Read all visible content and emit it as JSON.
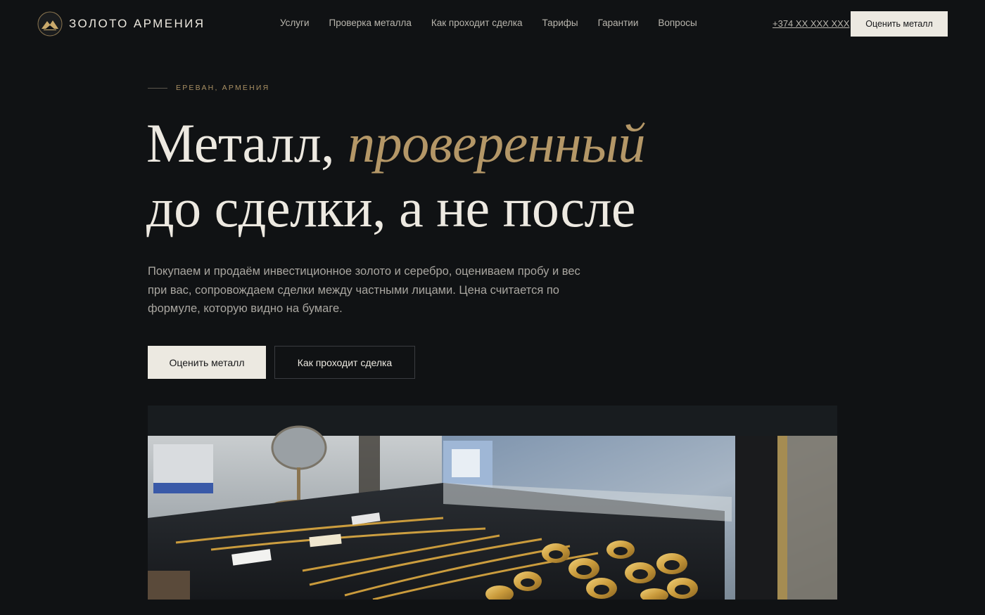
{
  "brand": {
    "name": "ЗОЛОТО АРМЕНИЯ",
    "logo_icon": "mountain-logo-icon"
  },
  "nav": {
    "items": [
      {
        "label": "Услуги"
      },
      {
        "label": "Проверка металла"
      },
      {
        "label": "Как проходит сделка"
      },
      {
        "label": "Тарифы"
      },
      {
        "label": "Гарантии"
      },
      {
        "label": "Вопросы"
      }
    ]
  },
  "header": {
    "phone": "+374 XX XXX XXX",
    "cta_label": "Оценить металл"
  },
  "hero": {
    "eyebrow": "ЕРЕВАН, АРМЕНИЯ",
    "title_part1": "Металл, ",
    "title_accent": "проверенный",
    "title_part2": "до сделки, а не после",
    "lead": "Покупаем и продаём инвестиционное золото и серебро, оцениваем пробу и вес при вас, сопровождаем сделки между частными лицами. Цена считается по формуле, которую видно на бумаге.",
    "primary_label": "Оценить металл",
    "secondary_label": "Как проходит сделка"
  },
  "colors": {
    "background": "#101214",
    "accent_gold": "#b49767",
    "button_light": "#ece9e1",
    "text_muted": "#a9a6a0"
  }
}
